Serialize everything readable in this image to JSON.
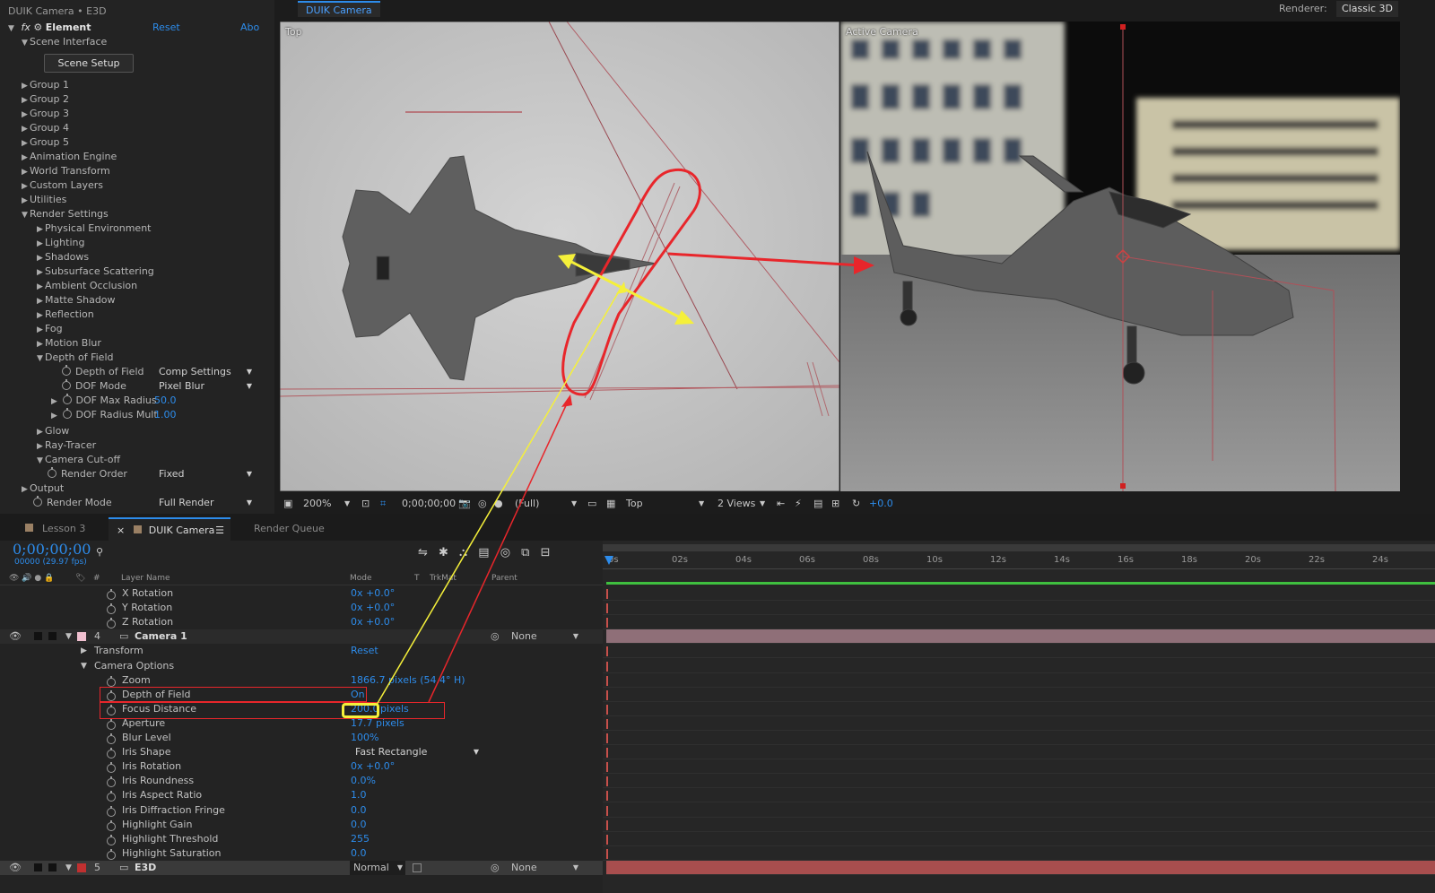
{
  "effect_panel": {
    "header": "DUIK Camera • E3D",
    "effect_name": "Element",
    "reset": "Reset",
    "about": "Abo",
    "items": [
      {
        "label": "Scene Interface",
        "level": 0,
        "open": true
      },
      {
        "label": "Group 1",
        "level": 0
      },
      {
        "label": "Group 2",
        "level": 0
      },
      {
        "label": "Group 3",
        "level": 0
      },
      {
        "label": "Group 4",
        "level": 0
      },
      {
        "label": "Group 5",
        "level": 0
      },
      {
        "label": "Animation Engine",
        "level": 0
      },
      {
        "label": "World Transform",
        "level": 0
      },
      {
        "label": "Custom Layers",
        "level": 0
      },
      {
        "label": "Utilities",
        "level": 0
      },
      {
        "label": "Render Settings",
        "level": 0,
        "open": true
      },
      {
        "label": "Physical Environment",
        "level": 1
      },
      {
        "label": "Lighting",
        "level": 1
      },
      {
        "label": "Shadows",
        "level": 1
      },
      {
        "label": "Subsurface Scattering",
        "level": 1
      },
      {
        "label": "Ambient Occlusion",
        "level": 1
      },
      {
        "label": "Matte Shadow",
        "level": 1
      },
      {
        "label": "Reflection",
        "level": 1
      },
      {
        "label": "Fog",
        "level": 1
      },
      {
        "label": "Motion Blur",
        "level": 1
      },
      {
        "label": "Depth of Field",
        "level": 1,
        "open": true
      },
      {
        "label": "Glow",
        "level": 1
      },
      {
        "label": "Ray-Tracer",
        "level": 1
      },
      {
        "label": "Camera Cut-off",
        "level": 1,
        "open": true
      },
      {
        "label": "Output",
        "level": 0
      }
    ],
    "scene_setup": "Scene Setup",
    "dof_props": [
      {
        "label": "Depth of Field",
        "value": "Comp Settings",
        "kind": "dropdown"
      },
      {
        "label": "DOF Mode",
        "value": "Pixel Blur",
        "kind": "dropdown"
      },
      {
        "label": "DOF Max Radius",
        "value": "50.0",
        "kind": "number"
      },
      {
        "label": "DOF Radius Mult",
        "value": "1.00",
        "kind": "number"
      }
    ],
    "render_order": {
      "label": "Render Order",
      "value": "Fixed"
    },
    "render_mode": {
      "label": "Render Mode",
      "value": "Full Render"
    }
  },
  "comp": {
    "tab": "DUIK Camera",
    "renderer_label": "Renderer:",
    "renderer_value": "Classic 3D",
    "view_top_label": "Top",
    "view_cam_label": "Active Camera",
    "toolbar": {
      "zoom": "200%",
      "timecode": "0;00;00;00",
      "resolution": "(Full)",
      "view": "Top",
      "views": "2 Views",
      "exposure": "+0.0"
    }
  },
  "timeline": {
    "tabs": [
      "Lesson 3",
      "DUIK Camera",
      "Render Queue"
    ],
    "timecode": "0;00;00;00",
    "fps": "00000 (29.97 fps)",
    "cols": {
      "num": "#",
      "layer_name": "Layer Name",
      "mode": "Mode",
      "t": "T",
      "trkmat": "TrkMat",
      "parent": "Parent"
    },
    "ruler": [
      "0s",
      "02s",
      "04s",
      "06s",
      "08s",
      "10s",
      "12s",
      "14s",
      "16s",
      "18s",
      "20s",
      "22s",
      "24s"
    ],
    "rows": [
      {
        "label": "X Rotation",
        "value": "0x +0.0°",
        "indent": 3
      },
      {
        "label": "Y Rotation",
        "value": "0x +0.0°",
        "indent": 3
      },
      {
        "label": "Z Rotation",
        "value": "0x +0.0°",
        "indent": 3
      },
      {
        "layer": true,
        "num": "4",
        "label": "Camera 1",
        "parent": "None",
        "color": "#f0c0d0"
      },
      {
        "label": "Transform",
        "value": "Reset",
        "indent": 1,
        "tri": "▶"
      },
      {
        "label": "Camera Options",
        "indent": 1,
        "tri": "▼"
      },
      {
        "label": "Zoom",
        "value": "1866.7 pixels (54.4° H)",
        "indent": 3
      },
      {
        "label": "Depth of Field",
        "value": "On",
        "indent": 3
      },
      {
        "label": "Focus Distance",
        "value": "200.0",
        "unit": "pixels",
        "indent": 3
      },
      {
        "label": "Aperture",
        "value": "17.7 pixels",
        "indent": 3
      },
      {
        "label": "Blur Level",
        "value": "100%",
        "indent": 3
      },
      {
        "label": "Iris Shape",
        "value": "Fast Rectangle",
        "indent": 3,
        "dropdown": true
      },
      {
        "label": "Iris Rotation",
        "value": "0x +0.0°",
        "indent": 3
      },
      {
        "label": "Iris Roundness",
        "value": "0.0%",
        "indent": 3
      },
      {
        "label": "Iris Aspect Ratio",
        "value": "1.0",
        "indent": 3
      },
      {
        "label": "Iris Diffraction Fringe",
        "value": "0.0",
        "indent": 3
      },
      {
        "label": "Highlight Gain",
        "value": "0.0",
        "indent": 3
      },
      {
        "label": "Highlight Threshold",
        "value": "255",
        "indent": 3
      },
      {
        "label": "Highlight Saturation",
        "value": "0.0",
        "indent": 3
      },
      {
        "layer": true,
        "num": "5",
        "label": "E3D",
        "mode": "Normal",
        "parent": "None",
        "color": "#c03030"
      }
    ]
  },
  "colors": {
    "accent": "#2d8ceb",
    "annotation_red": "#e8262b",
    "annotation_yellow": "#f5f03a",
    "camera_bar": "#8f6f78",
    "e3d_bar": "#a84e4e",
    "work_area": "#3fbf3f"
  }
}
